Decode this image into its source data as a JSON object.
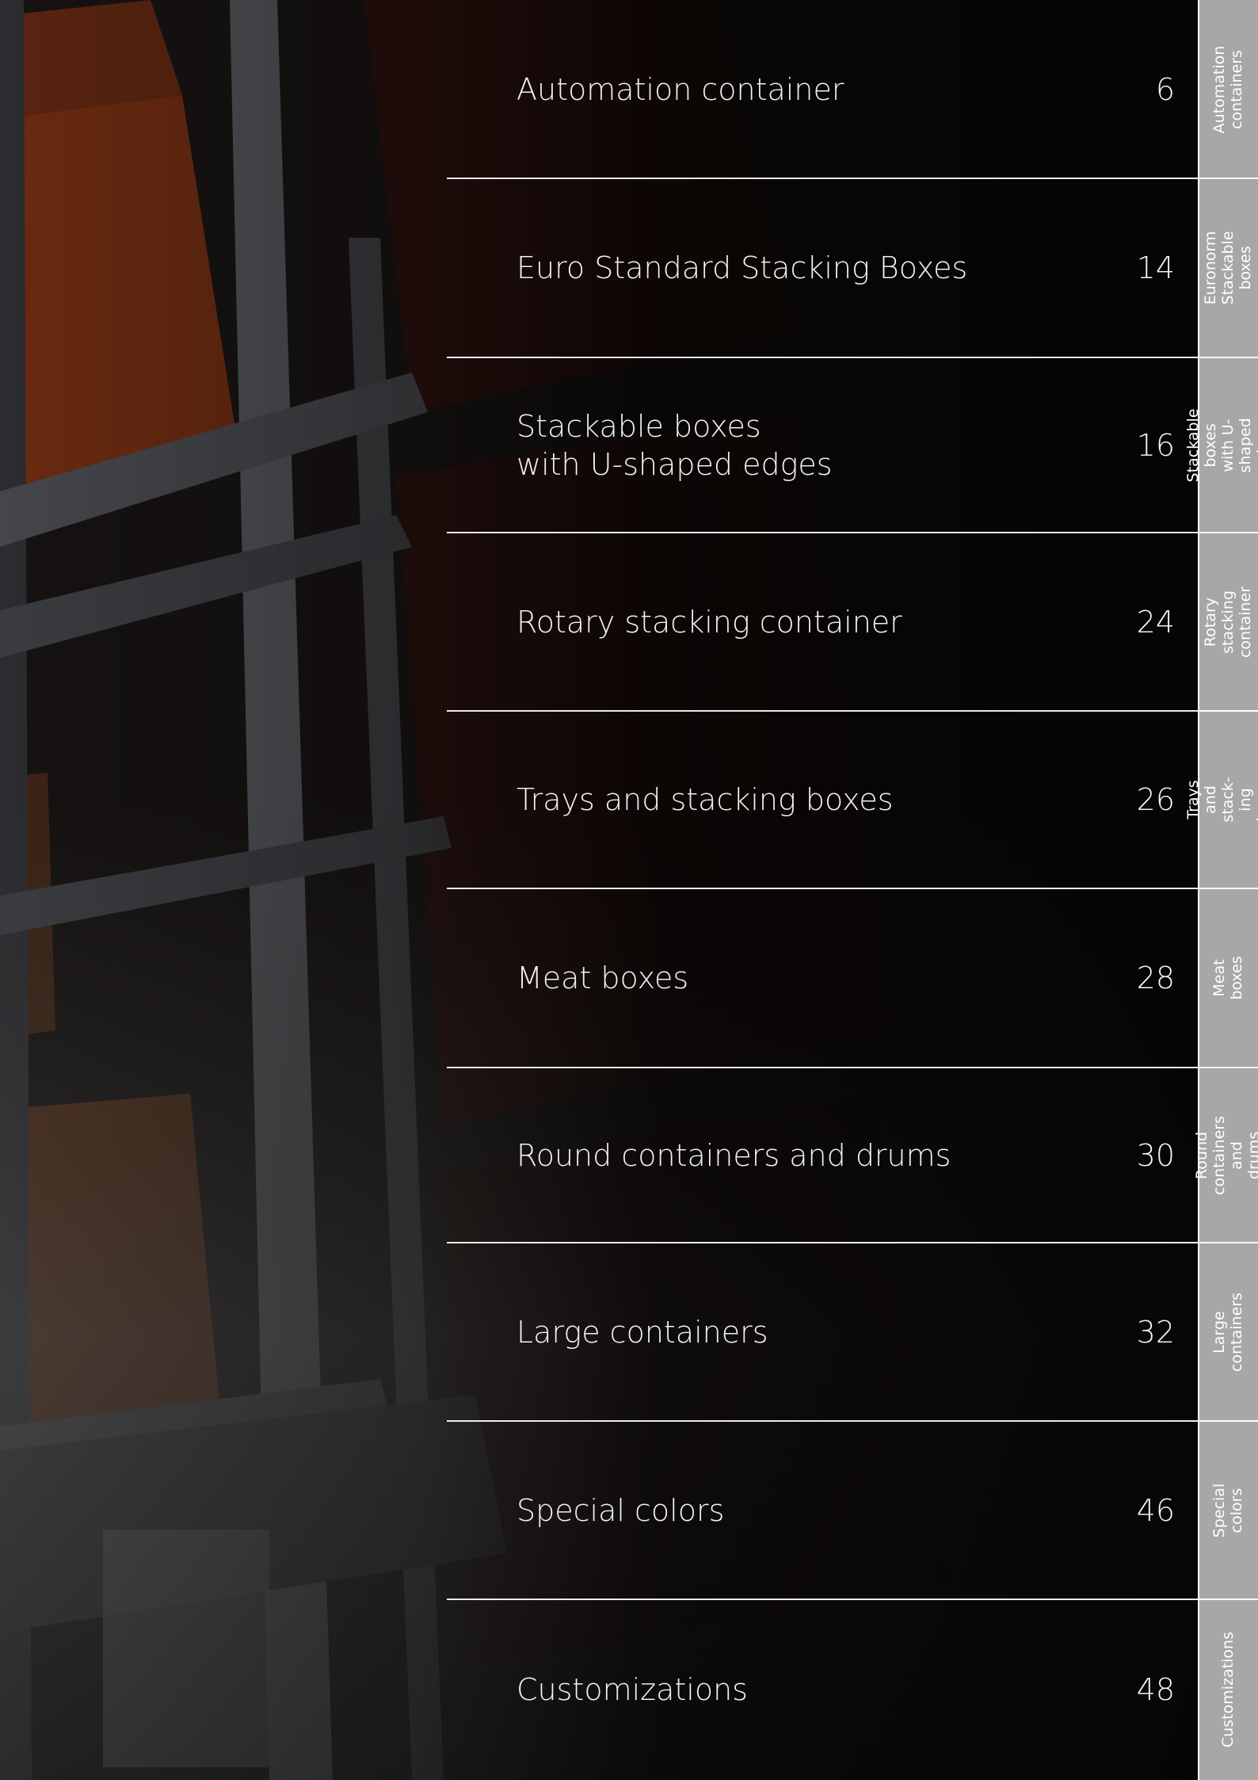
{
  "toc": {
    "entries": [
      {
        "title": "Automation container",
        "page": "6"
      },
      {
        "title": "Euro Standard Stacking Boxes",
        "page": "14"
      },
      {
        "title": "Stackable boxes\nwith U-shaped edges",
        "page": "16"
      },
      {
        "title": "Rotary stacking container",
        "page": "24"
      },
      {
        "title": "Trays and stacking boxes",
        "page": "26"
      },
      {
        "title": "Meat boxes",
        "page": "28"
      },
      {
        "title": "Round containers and drums",
        "page": "30"
      },
      {
        "title": "Large containers",
        "page": "32"
      },
      {
        "title": "Special colors",
        "page": "46"
      },
      {
        "title": "Customizations",
        "page": "48"
      }
    ]
  },
  "tabs": [
    {
      "label": "Automation\ncontainers"
    },
    {
      "label": "Euronorm\nStackable boxes"
    },
    {
      "label": "Stackable boxes\nwith U-shaped edges"
    },
    {
      "label": "Rotary stacking\ncontainer"
    },
    {
      "label": "Trays and stack-\ning boxes"
    },
    {
      "label": "Meat boxes"
    },
    {
      "label": "Round containers\nand drums"
    },
    {
      "label": "Large containers"
    },
    {
      "label": "Special colors"
    },
    {
      "label": "Customizations"
    }
  ],
  "colors": {
    "tab_background": "#a7a7a9",
    "page_background": "#0b0707",
    "text": "#f2f2f2"
  }
}
